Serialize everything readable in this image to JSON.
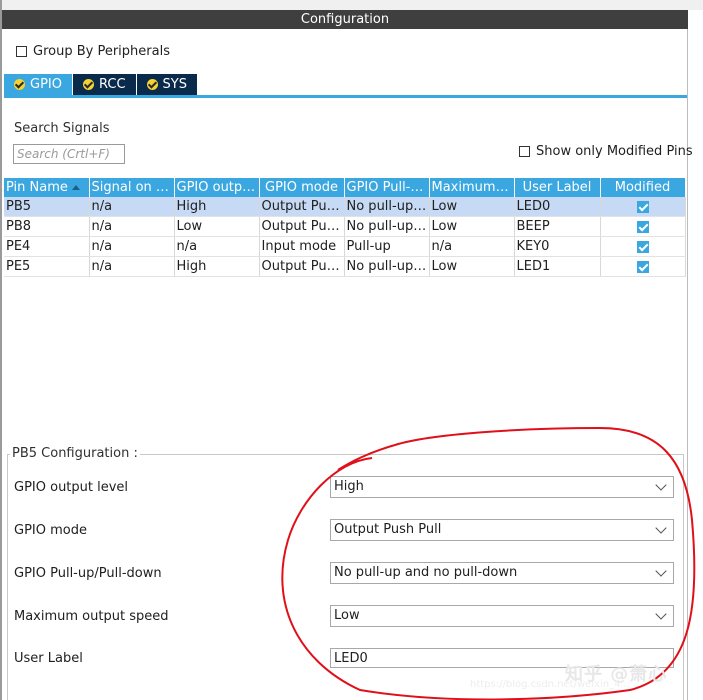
{
  "window": {
    "title": "Configuration"
  },
  "options": {
    "group_by_label": "Group By Peripherals",
    "search_label": "Search Signals",
    "search_placeholder": "Search (Crtl+F)",
    "show_modified_label": "Show only Modified Pins"
  },
  "tabs": [
    {
      "label": "GPIO",
      "active": true
    },
    {
      "label": "RCC",
      "active": false
    },
    {
      "label": "SYS",
      "active": false
    }
  ],
  "table": {
    "headers": [
      "Pin Name",
      "Signal on Pin",
      "GPIO outpu...",
      "GPIO mode",
      "GPIO Pull-u...",
      "Maximum o...",
      "User Label",
      "Modified"
    ],
    "rows": [
      {
        "pin": "PB5",
        "signal": "n/a",
        "output": "High",
        "mode": "Output Pus...",
        "pull": "No pull-up a...",
        "speed": "Low",
        "label": "LED0",
        "modified": true,
        "selected": true
      },
      {
        "pin": "PB8",
        "signal": "n/a",
        "output": "Low",
        "mode": "Output Pus...",
        "pull": "No pull-up a...",
        "speed": "Low",
        "label": "BEEP",
        "modified": true,
        "selected": false
      },
      {
        "pin": "PE4",
        "signal": "n/a",
        "output": "n/a",
        "mode": "Input mode",
        "pull": "Pull-up",
        "speed": "n/a",
        "label": "KEY0",
        "modified": true,
        "selected": false
      },
      {
        "pin": "PE5",
        "signal": "n/a",
        "output": "High",
        "mode": "Output Pus...",
        "pull": "No pull-up a...",
        "speed": "Low",
        "label": "LED1",
        "modified": true,
        "selected": false
      }
    ]
  },
  "config": {
    "title": "PB5 Configuration :",
    "fields": [
      {
        "label": "GPIO output level",
        "value": "High"
      },
      {
        "label": "GPIO mode",
        "value": "Output Push Pull"
      },
      {
        "label": "GPIO Pull-up/Pull-down",
        "value": "No pull-up and no pull-down"
      },
      {
        "label": "Maximum output speed",
        "value": "Low"
      }
    ],
    "user_label": {
      "label": "User Label",
      "value": "LED0"
    }
  },
  "watermark": {
    "text": "知乎 @萧心",
    "url": "https://blog.csdn.net/weixin_4..."
  },
  "colors": {
    "accent": "#3ba7e0",
    "tab_inactive": "#0a2a4c",
    "title_bar": "#3f3f3f",
    "selected_row": "#c7daf5",
    "annotation": "#e0101a"
  }
}
